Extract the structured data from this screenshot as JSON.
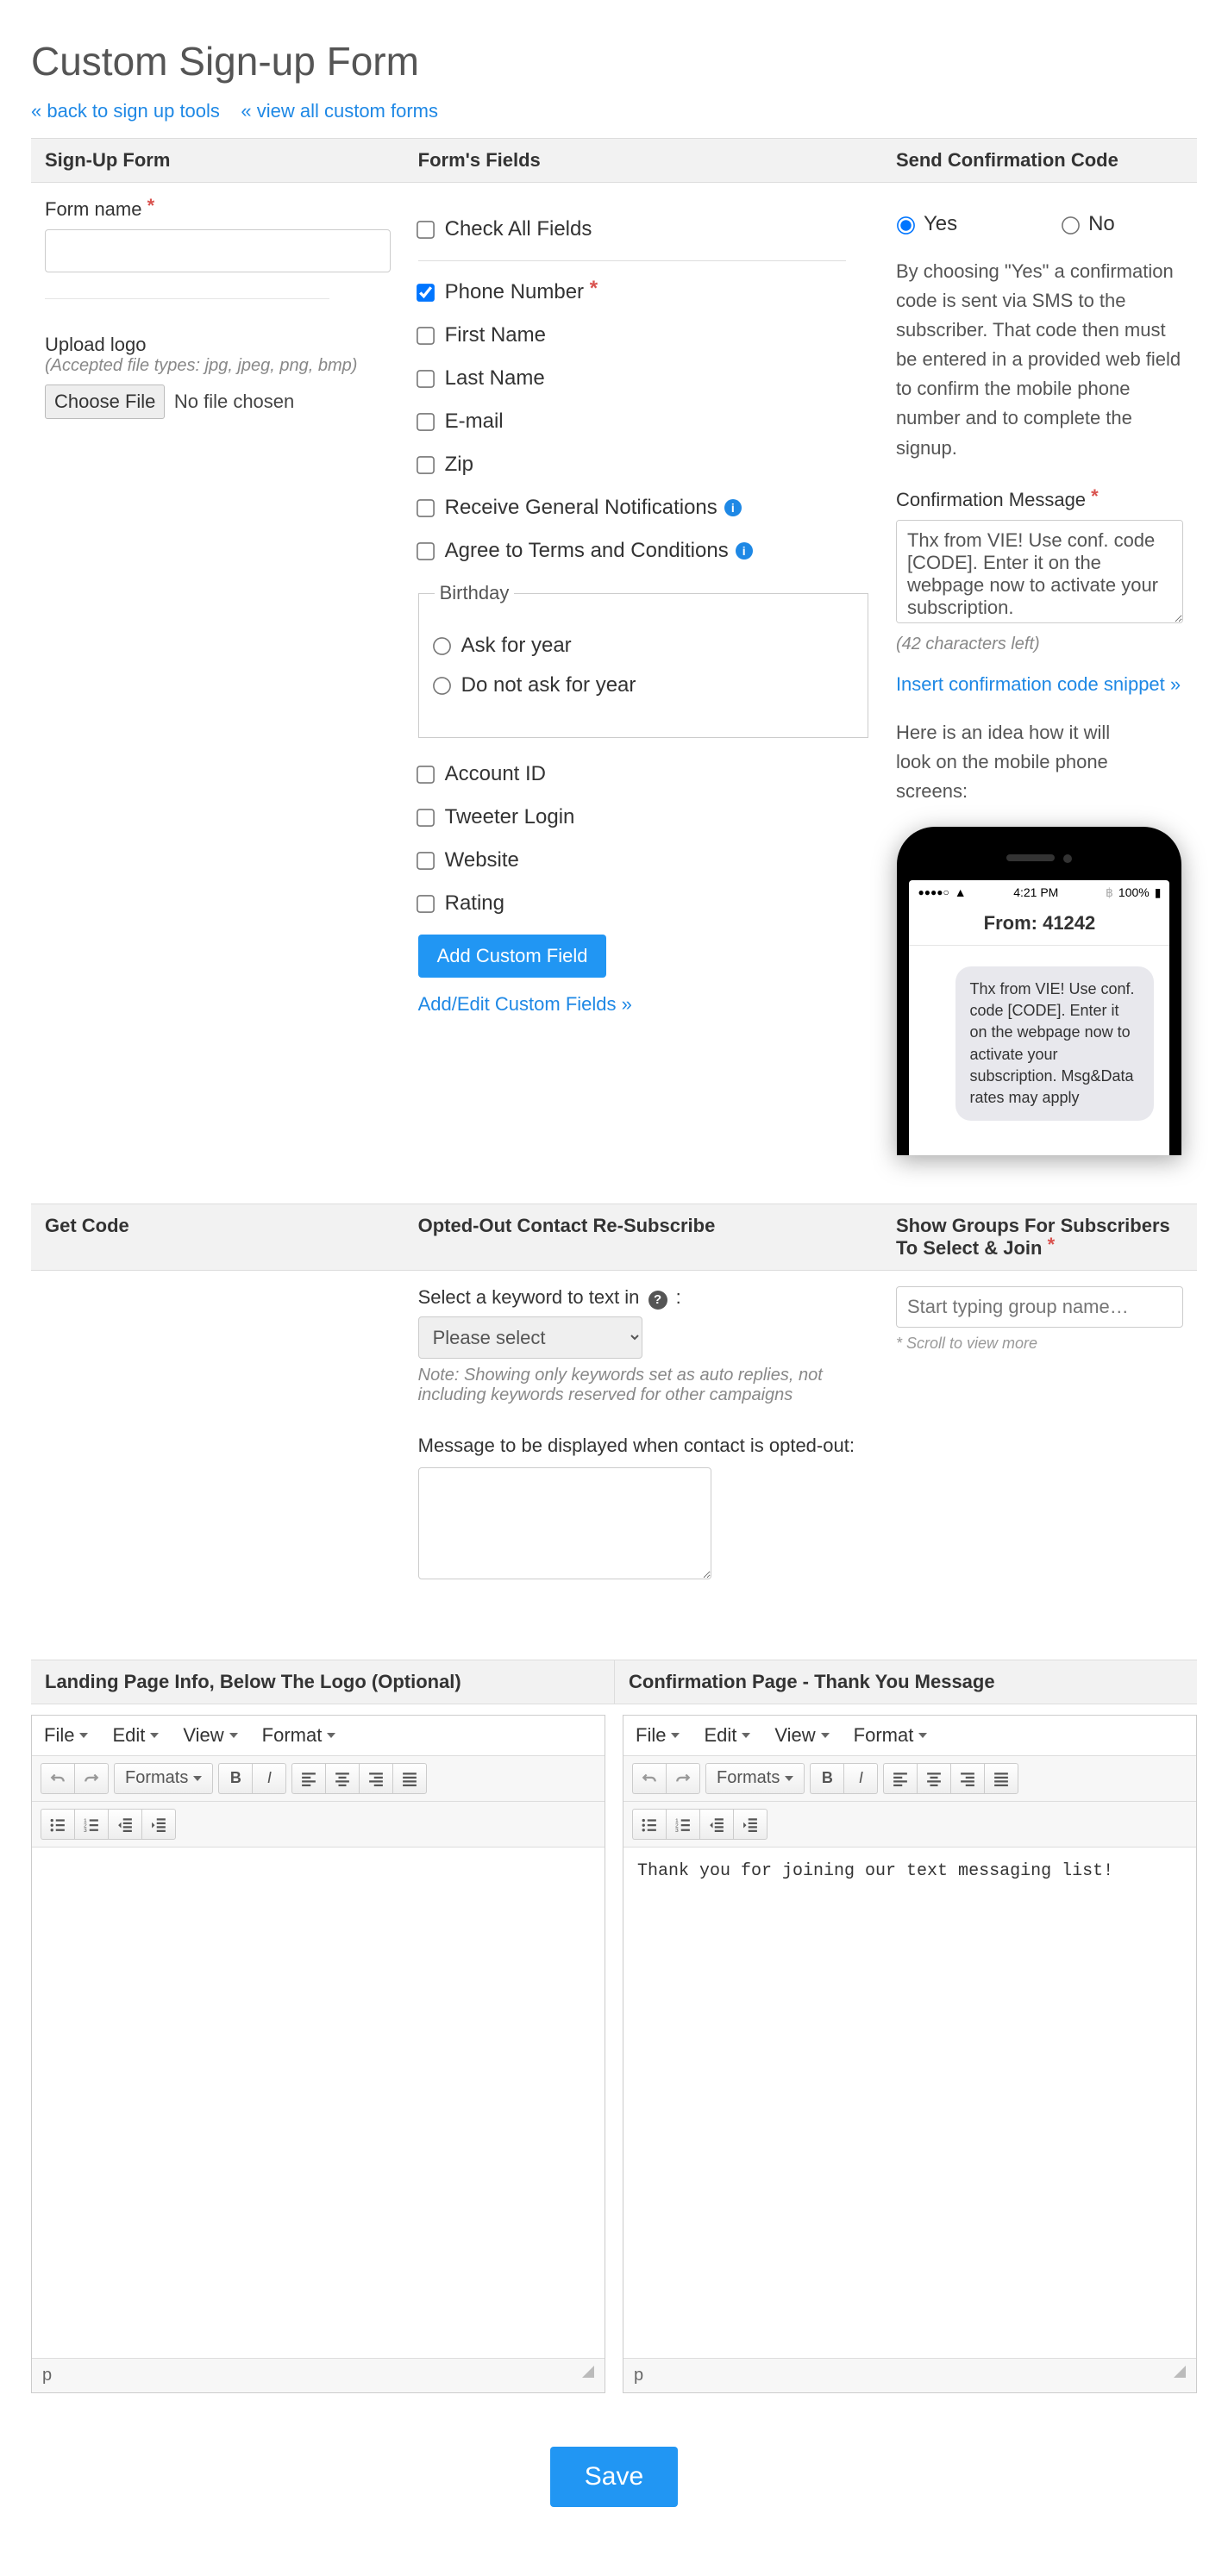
{
  "page": {
    "title": "Custom Sign-up Form"
  },
  "links": {
    "back": "« back to sign up tools",
    "viewAll": "« view all custom forms"
  },
  "headers": {
    "signup": "Sign-Up Form",
    "fields": "Form's Fields",
    "confirm": "Send Confirmation Code",
    "getCode": "Get Code",
    "resub": "Opted-Out Contact Re-Subscribe",
    "groups": "Show Groups For Subscribers To Select & Join",
    "landing": "Landing Page Info, Below The Logo (Optional)",
    "thankyou": "Confirmation Page - Thank You Message"
  },
  "signup": {
    "formNameLabel": "Form name",
    "uploadLabel": "Upload logo",
    "uploadHint": "(Accepted file types: jpg, jpeg, png, bmp)",
    "chooseFile": "Choose File",
    "noFile": "No file chosen"
  },
  "fields": {
    "checkAll": "Check All Fields",
    "items": [
      {
        "label": "Phone Number",
        "checked": true,
        "required": true
      },
      {
        "label": "First Name"
      },
      {
        "label": "Last Name"
      },
      {
        "label": "E-mail"
      },
      {
        "label": "Zip"
      },
      {
        "label": "Receive General Notifications",
        "info": true
      },
      {
        "label": "Agree to Terms and Conditions",
        "info": true
      }
    ],
    "birthday": {
      "legend": "Birthday",
      "ask": "Ask for year",
      "noask": "Do not ask for year"
    },
    "items2": [
      {
        "label": "Account ID"
      },
      {
        "label": "Tweeter Login"
      },
      {
        "label": "Website"
      },
      {
        "label": "Rating"
      }
    ],
    "addBtn": "Add Custom Field",
    "editLink": "Add/Edit Custom Fields »"
  },
  "confirm": {
    "yes": "Yes",
    "no": "No",
    "desc": "By choosing \"Yes\" a confirmation code is sent via SMS to the subscriber. That code then must be entered in a provided web field to confirm the mobile phone number and to complete the signup.",
    "msgLabel": "Confirmation Message",
    "msgValue": "Thx from VIE! Use conf. code [CODE]. Enter it on the webpage now to activate your subscription.",
    "charsLeft": "(42 characters left)",
    "insertLink": "Insert confirmation code snippet »",
    "previewIntro": "Here is an idea how it will look on the mobile phone screens:",
    "phone": {
      "time": "4:21 PM",
      "battery": "100%",
      "from": "From: 41242",
      "bubble": "Thx from VIE! Use conf. code [CODE]. Enter it on the webpage now to activate your subscription.\nMsg&Data rates may apply"
    }
  },
  "resub": {
    "kwLabel": "Select a keyword to text in",
    "kwPlaceholder": "Please select",
    "kwNote": "Note: Showing only keywords set as auto replies, not including keywords reserved for other campaigns",
    "optedOutLabel": "Message to be displayed when contact is opted-out:"
  },
  "groups": {
    "placeholder": "Start typing group name…",
    "note": "* Scroll to view more"
  },
  "editor": {
    "menus": [
      "File",
      "Edit",
      "View",
      "Format"
    ],
    "formatsBtn": "Formats",
    "thankyouText": "Thank you for joining our text messaging list!",
    "statusP": "p"
  },
  "save": "Save"
}
